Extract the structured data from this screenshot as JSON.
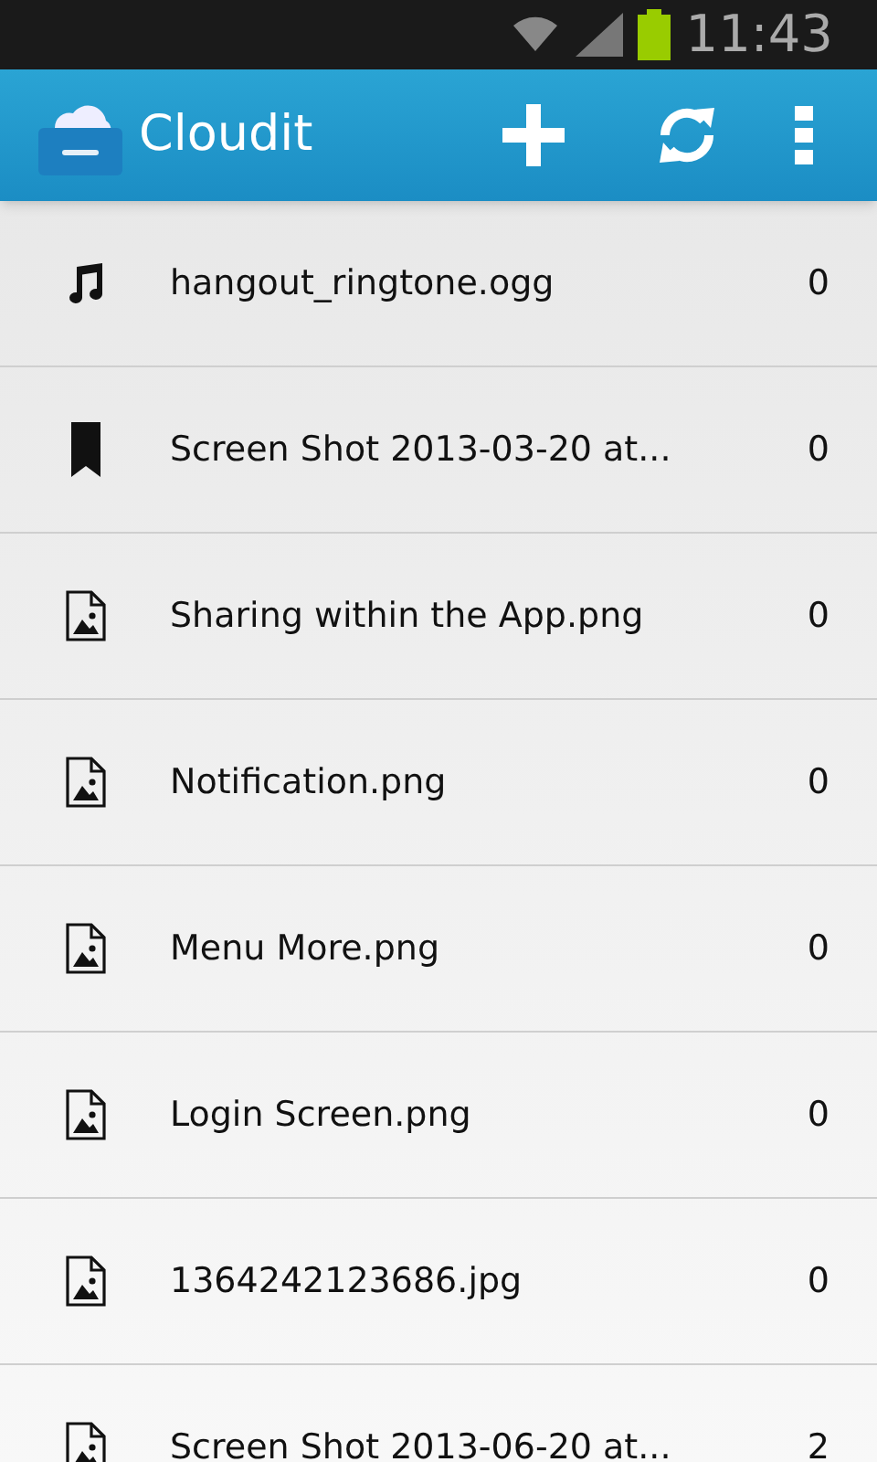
{
  "status_bar": {
    "time": "11:43"
  },
  "app_bar": {
    "title": "Cloudit"
  },
  "files": [
    {
      "kind": "audio",
      "name": "hangout_ringtone.ogg",
      "count": "0"
    },
    {
      "kind": "bookmark",
      "name": "Screen Shot 2013-03-20 at...",
      "count": "0"
    },
    {
      "kind": "image",
      "name": "Sharing within the App.png",
      "count": "0"
    },
    {
      "kind": "image",
      "name": "Notification.png",
      "count": "0"
    },
    {
      "kind": "image",
      "name": "Menu More.png",
      "count": "0"
    },
    {
      "kind": "image",
      "name": "Login Screen.png",
      "count": "0"
    },
    {
      "kind": "image",
      "name": "1364242123686.jpg",
      "count": "0"
    },
    {
      "kind": "image",
      "name": "Screen Shot 2013-06-20 at...",
      "count": "2"
    }
  ]
}
